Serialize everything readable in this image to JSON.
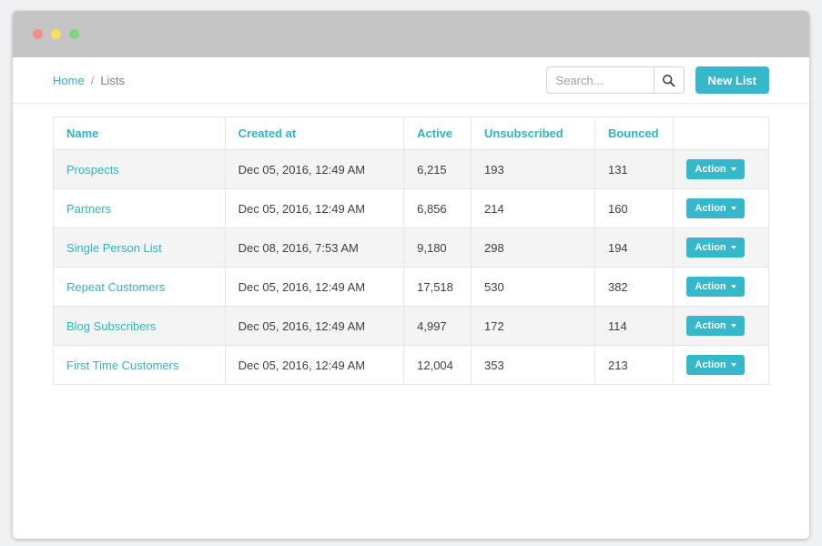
{
  "colors": {
    "accent": "#35b8c9",
    "titlebar": "#c5c5c5",
    "row_stripe": "#f4f4f4"
  },
  "window": {
    "traffic_lights": [
      "close",
      "minimize",
      "maximize"
    ]
  },
  "breadcrumb": {
    "home": "Home",
    "separator": "/",
    "current": "Lists"
  },
  "search": {
    "placeholder": "Search...",
    "icon": "magnifier"
  },
  "buttons": {
    "new_list": "New List"
  },
  "table": {
    "headers": [
      "Name",
      "Created at",
      "Active",
      "Unsubscribed",
      "Bounced",
      ""
    ],
    "rows": [
      {
        "name": "Prospects",
        "created_at": "Dec 05, 2016, 12:49 AM",
        "active": "6,215",
        "unsubscribed": "193",
        "bounced": "131",
        "action": "Action"
      },
      {
        "name": "Partners",
        "created_at": "Dec 05, 2016, 12:49 AM",
        "active": "6,856",
        "unsubscribed": "214",
        "bounced": "160",
        "action": "Action"
      },
      {
        "name": "Single Person List",
        "created_at": "Dec 08, 2016, 7:53 AM",
        "active": "9,180",
        "unsubscribed": "298",
        "bounced": "194",
        "action": "Action"
      },
      {
        "name": "Repeat Customers",
        "created_at": "Dec 05, 2016, 12:49 AM",
        "active": "17,518",
        "unsubscribed": "530",
        "bounced": "382",
        "action": "Action"
      },
      {
        "name": "Blog Subscribers",
        "created_at": "Dec 05, 2016, 12:49 AM",
        "active": "4,997",
        "unsubscribed": "172",
        "bounced": "114",
        "action": "Action"
      },
      {
        "name": "First Time Customers",
        "created_at": "Dec 05, 2016, 12:49 AM",
        "active": "12,004",
        "unsubscribed": "353",
        "bounced": "213",
        "action": "Action"
      }
    ]
  }
}
